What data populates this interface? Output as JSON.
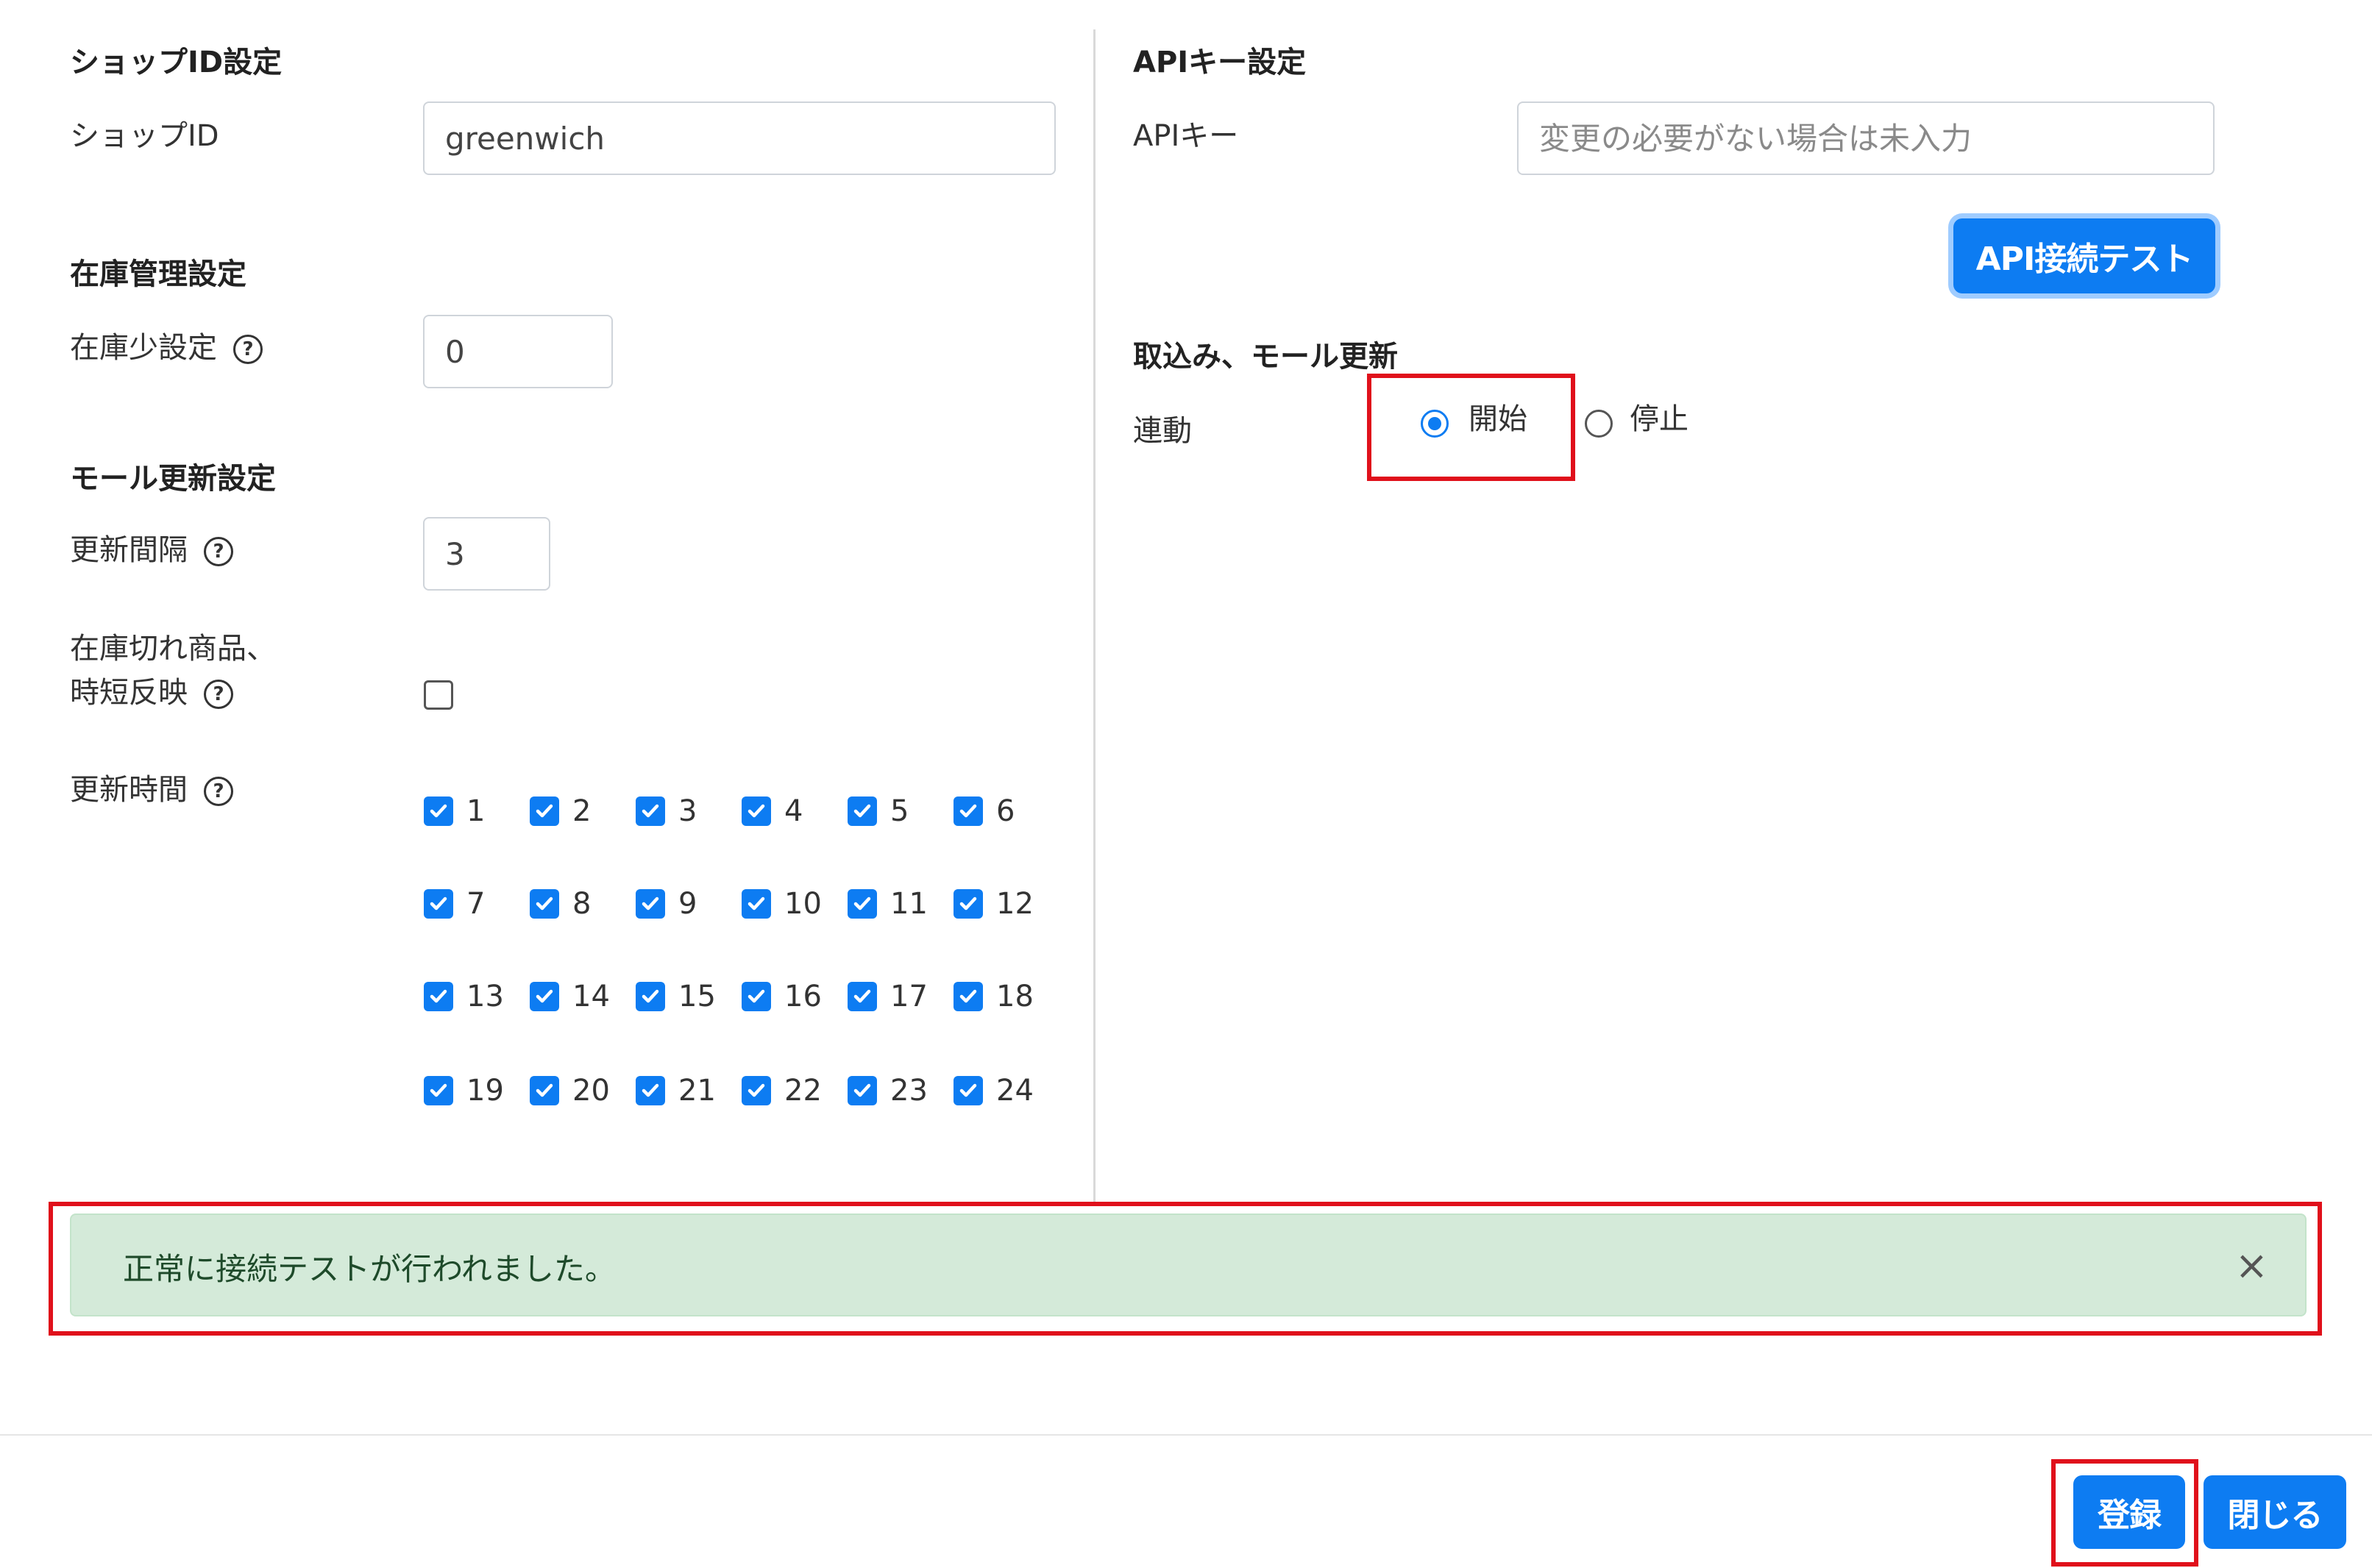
{
  "left": {
    "shop_id_section": {
      "title": "ショップID設定",
      "label": "ショップID",
      "value": "greenwich"
    },
    "stock_section": {
      "title": "在庫管理設定",
      "label": "在庫少設定",
      "value": "0"
    },
    "mall_section": {
      "title": "モール更新設定",
      "interval_label": "更新間隔",
      "interval_value": "3",
      "out_of_stock_label_line1": "在庫切れ商品、",
      "out_of_stock_label_line2": "時短反映",
      "out_of_stock_checked": false,
      "update_time_label": "更新時間",
      "hours": [
        "1",
        "2",
        "3",
        "4",
        "5",
        "6",
        "7",
        "8",
        "9",
        "10",
        "11",
        "12",
        "13",
        "14",
        "15",
        "16",
        "17",
        "18",
        "19",
        "20",
        "21",
        "22",
        "23",
        "24"
      ],
      "hours_checked": true
    },
    "help_icon": "question-circle-icon"
  },
  "right": {
    "api_section": {
      "title": "APIキー設定",
      "label": "APIキー",
      "placeholder": "変更の必要がない場合は未入力",
      "test_button": "API接続テスト"
    },
    "import_section": {
      "title": "取込み、モール更新",
      "link_label": "連動",
      "options": [
        {
          "label": "開始",
          "selected": true
        },
        {
          "label": "停止",
          "selected": false
        }
      ]
    }
  },
  "alert": {
    "message": "正常に接続テストが行われました。",
    "close": "×"
  },
  "footer": {
    "register_button": "登録",
    "close_button": "閉じる"
  },
  "colors": {
    "primary": "#0d7cf2",
    "highlight": "#e0101b",
    "success_bg": "#d4ead9"
  }
}
